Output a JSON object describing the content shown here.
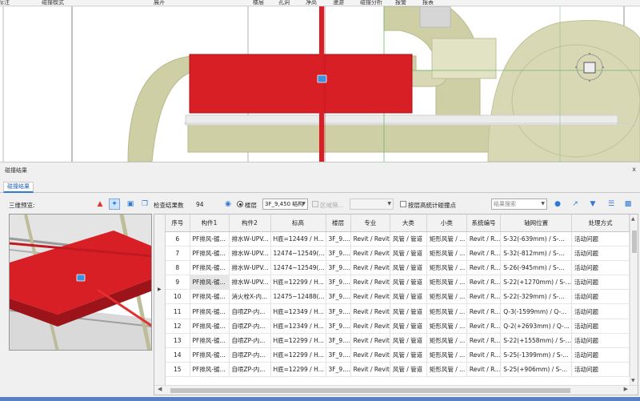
{
  "ribbon": {
    "items": [
      "l标注",
      "碰撞模式",
      "展开",
      "楼层",
      "孔洞",
      "净高",
      "漫游",
      "碰撞分析",
      "报警",
      "报表"
    ]
  },
  "viewport": {
    "badge_icon": "clash-marker-icon",
    "compass_icon": "view-cube-icon"
  },
  "panel": {
    "title": "碰撞结果",
    "close": "x",
    "tab": "碰撞结果"
  },
  "toolbar": {
    "preview_label": "三维预览:",
    "count_label": "检查结果数",
    "count_value": "94",
    "floor_label": "楼层",
    "floor_value": "3F_9,450 结构",
    "area_label": "区域筛...",
    "floor_elev_label": "按层高统计碰撞点",
    "search_placeholder": "结果搜索"
  },
  "table": {
    "columns": [
      "序号",
      "构件1",
      "构件2",
      "标高",
      "楼层",
      "专业",
      "大类",
      "小类",
      "系统编号",
      "轴网位置",
      "处理方式"
    ],
    "rows": [
      [
        "6",
        "PF排风-镀...",
        "排水W-UPV...",
        "H底=12449 / H...",
        "3F_9....",
        "Revit / Revit",
        "风管 / 管道",
        "矩形风管 / ...",
        "Revit / R...",
        "S-32(-639mm) / S-...",
        "活动问题"
      ],
      [
        "7",
        "PF排风-镀...",
        "排水W-UPV...",
        "12474~12549(...",
        "3F_9....",
        "Revit / Revit",
        "风管 / 管道",
        "矩形风管 / ...",
        "Revit / R...",
        "S-32(-812mm) / S-...",
        "活动问题"
      ],
      [
        "8",
        "PF排风-镀...",
        "排水W-UPV...",
        "12474~12549(...",
        "3F_9....",
        "Revit / Revit",
        "风管 / 管道",
        "矩形风管 / ...",
        "Revit / R...",
        "S-26(-945mm) / S-...",
        "活动问题"
      ],
      [
        "9",
        "PF排风-镀...",
        "排水W-UPV...",
        "H底=12299 / H...",
        "3F_9....",
        "Revit / Revit",
        "风管 / 管道",
        "矩形风管 / ...",
        "Revit / R...",
        "S-22(+1270mm) / S-...",
        "活动问题"
      ],
      [
        "10",
        "PF排风-镀...",
        "消火栓X-内...",
        "12475~12488(...",
        "3F_9....",
        "Revit / Revit",
        "风管 / 管道",
        "矩形风管 / ...",
        "Revit / R...",
        "S-22(-329mm) / S-...",
        "活动问题"
      ],
      [
        "11",
        "PF排风-镀...",
        "自喷ZP-内...",
        "H底=12349 / H...",
        "3F_9....",
        "Revit / Revit",
        "风管 / 管道",
        "矩形风管 / ...",
        "Revit / R...",
        "Q-3(-1599mm) / Q-...",
        "活动问题"
      ],
      [
        "12",
        "PF排风-镀...",
        "自喷ZP-内...",
        "H底=12349 / H...",
        "3F_9....",
        "Revit / Revit",
        "风管 / 管道",
        "矩形风管 / ...",
        "Revit / R...",
        "Q-2(+2693mm) / Q-...",
        "活动问题"
      ],
      [
        "13",
        "PF排风-镀...",
        "自喷ZP-内...",
        "H底=12299 / H...",
        "3F_9....",
        "Revit / Revit",
        "风管 / 管道",
        "矩形风管 / ...",
        "Revit / R...",
        "S-22(+1558mm) / S-...",
        "活动问题"
      ],
      [
        "14",
        "PF排风-镀...",
        "自喷ZP-内...",
        "H底=12299 / H...",
        "3F_9....",
        "Revit / Revit",
        "风管 / 管道",
        "矩形风管 / ...",
        "Revit / R...",
        "S-25(-1399mm) / S-...",
        "活动问题"
      ],
      [
        "15",
        "PF排风-镀...",
        "自喷ZP-内...",
        "H底=12299 / H...",
        "3F_9....",
        "Revit / Revit",
        "风管 / 管道",
        "矩形风管 / ...",
        "Revit / R...",
        "S-25(+906mm) / S-...",
        "活动问题"
      ]
    ]
  },
  "colors": {
    "duct_red": "#d81f26",
    "pipe_khaki": "#cfcfa6",
    "accent_blue": "#2e7bd6"
  }
}
